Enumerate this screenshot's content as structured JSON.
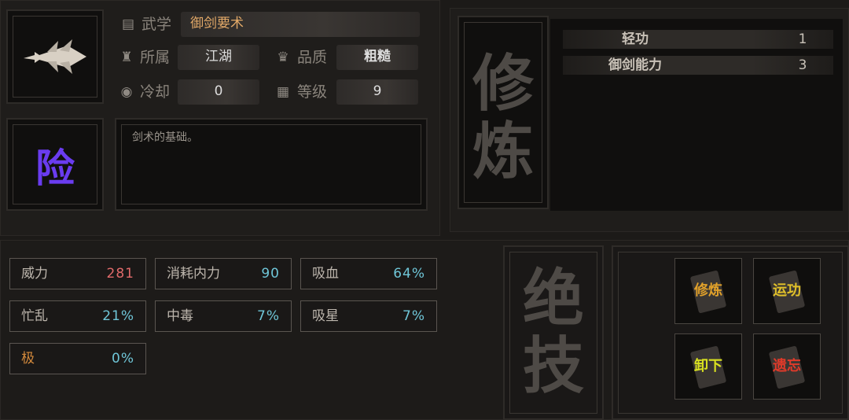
{
  "skill": {
    "wuxue_label": "武学",
    "name": "御剑要术",
    "suoshu_label": "所属",
    "suoshu_value": "江湖",
    "pinzhi_label": "品质",
    "pinzhi_value": "粗糙",
    "lengque_label": "冷却",
    "lengque_value": "0",
    "dengji_label": "等级",
    "dengji_value": "9",
    "type_char": "险",
    "description": "剑术的基础。"
  },
  "xiulian": {
    "title_top": "修",
    "title_bottom": "炼",
    "attrs": [
      {
        "name": "轻功",
        "value": "1"
      },
      {
        "name": "御剑能力",
        "value": "3"
      }
    ]
  },
  "stats": [
    {
      "name": "威力",
      "value": "281",
      "color": "#e06a6a"
    },
    {
      "name": "消耗内力",
      "value": "90"
    },
    {
      "name": "吸血",
      "value": "64%"
    },
    {
      "name": "忙乱",
      "value": "21%"
    },
    {
      "name": "中毒",
      "value": "7%"
    },
    {
      "name": "吸星",
      "value": "7%"
    },
    {
      "name": "极",
      "value": "0%",
      "name_color": "#d48a3c"
    }
  ],
  "juezhi": {
    "top": "绝",
    "bottom": "技"
  },
  "actions": [
    {
      "label": "修炼",
      "color": "#e0a02a"
    },
    {
      "label": "运功",
      "color": "#e0c02a"
    },
    {
      "label": "卸下",
      "color": "#d8e020"
    },
    {
      "label": "遗忘",
      "color": "#e03a2a"
    }
  ],
  "colors": {
    "accent_type_char": "#6a3cf0",
    "stat_value": "#6fc6d8"
  }
}
